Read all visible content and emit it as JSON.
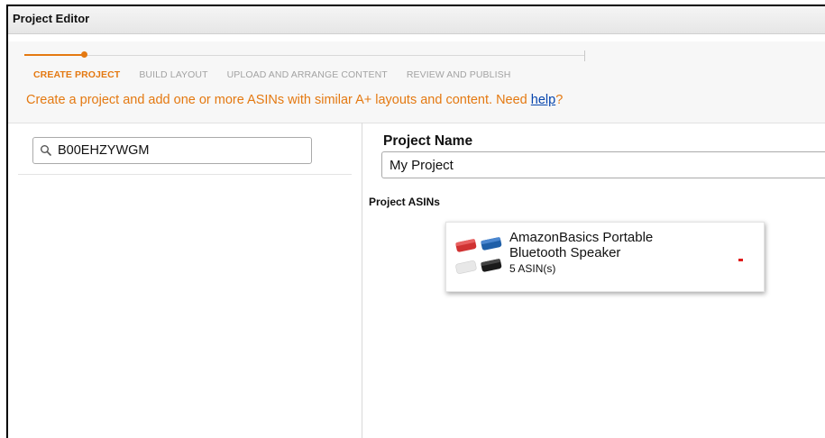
{
  "window": {
    "title": "Project Editor"
  },
  "wizard": {
    "steps": [
      {
        "label": "CREATE PROJECT",
        "active": true
      },
      {
        "label": "BUILD LAYOUT",
        "active": false
      },
      {
        "label": "UPLOAD AND ARRANGE CONTENT",
        "active": false
      },
      {
        "label": "REVIEW AND PUBLISH",
        "active": false
      }
    ],
    "accent_color": "#e47911"
  },
  "instructions": {
    "text": "Create a project and add one or more ASINs with similar A+ layouts and content. Need ",
    "help_link": "help",
    "suffix": "?"
  },
  "search": {
    "value": "B00EHZYWGM",
    "icon": "search-icon"
  },
  "project": {
    "name_label": "Project Name",
    "name_value": "My Project",
    "asins_label": "Project ASINs"
  },
  "asin_card": {
    "title": "AmazonBasics Portable Bluetooth Speaker",
    "count": "5 ASIN(s)",
    "remove_color": "#e01b1b",
    "swatches": [
      "#d03232",
      "#1f5fa8",
      "#e8e8e8",
      "#1a1a1a"
    ]
  }
}
